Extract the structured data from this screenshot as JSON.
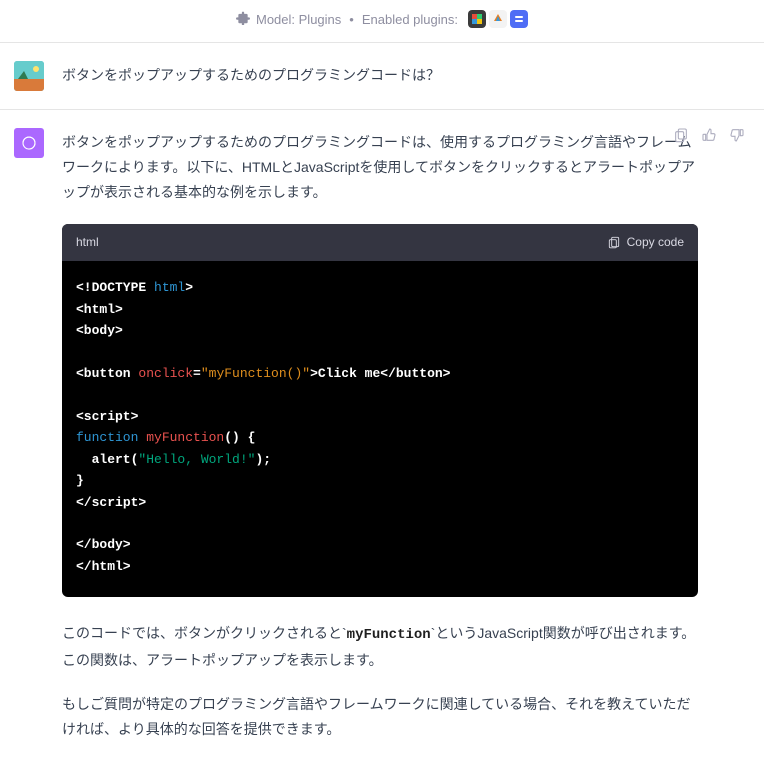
{
  "header": {
    "model_label": "Model: Plugins",
    "enabled_label": "Enabled plugins:"
  },
  "user": {
    "message": "ボタンをポップアップするためのプログラミングコードは？"
  },
  "assistant": {
    "intro": "ボタンをポップアップするためのプログラミングコードは、使用するプログラミング言語やフレームワークによります。以下に、HTMLとJavaScriptを使用してボタンをクリックするとアラートポップアップが表示される基本的な例を示します。",
    "code": {
      "lang": "html",
      "copy_label": "Copy code",
      "tokens": {
        "doctype_open": "<!DOCTYPE ",
        "doctype_html": "html",
        "doctype_close": ">",
        "html_open": "<html>",
        "body_open": "<body>",
        "button_open": "<button ",
        "onclick_attr": "onclick",
        "eq": "=",
        "onclick_val": "\"myFunction()\"",
        "button_mid": ">Click me</button>",
        "script_open": "<script>",
        "fn_kw": "function",
        "fn_name": " myFunction",
        "fn_parens": "() {",
        "alert_call": "  alert(",
        "alert_str": "\"Hello, World!\"",
        "alert_end": ");",
        "brace_close": "}",
        "script_close": "</scr",
        "script_close2": "ipt>",
        "body_close": "</body>",
        "html_close": "</html>"
      }
    },
    "explain1_a": "このコードでは、ボタンがクリックされると`",
    "explain1_fn": "myFunction",
    "explain1_b": "`というJavaScript関数が呼び出されます。この関数は、アラートポップアップを表示します。",
    "explain2": "もしご質問が特定のプログラミング言語やフレームワークに関連している場合、それを教えていただければ、より具体的な回答を提供できます。"
  }
}
